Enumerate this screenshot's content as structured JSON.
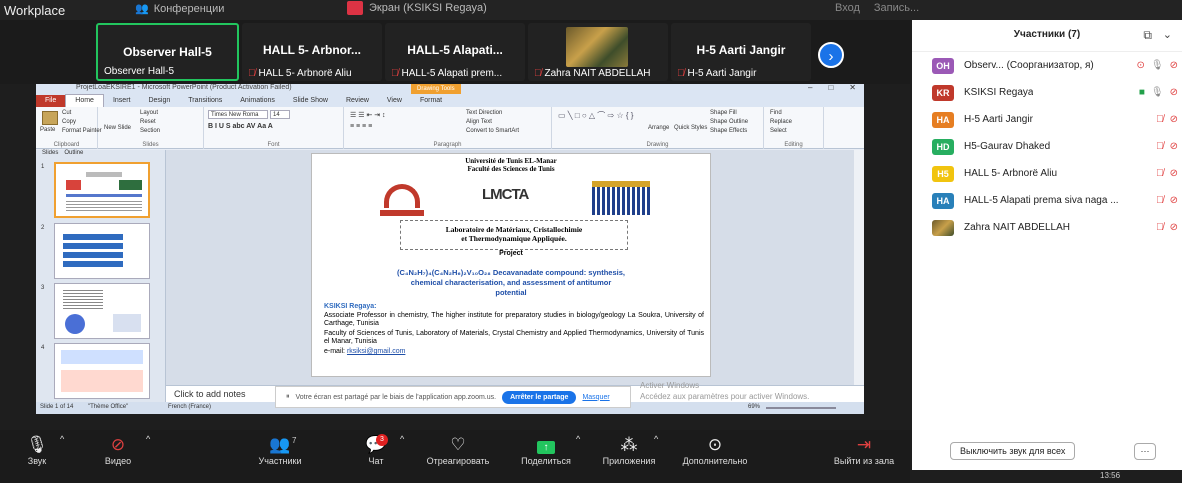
{
  "topbar": {
    "workspace": "Workplace",
    "conference_label": "Конференции",
    "share_label": "Экран (KSIKSI Regaya)",
    "right_items": [
      "Вход",
      "Запись..."
    ]
  },
  "strip": {
    "tiles": [
      {
        "big": "Observer  Hall-5",
        "small": "Observer  Hall-5",
        "muted": false
      },
      {
        "big": "HALL 5- Arbnor...",
        "small": "HALL 5- Arbnorë Aliu",
        "muted": true
      },
      {
        "big": "HALL-5 Alapati...",
        "small": "HALL-5 Alapati prem...",
        "muted": true
      },
      {
        "big": "",
        "small": "Zahra NAIT ABDELLAH",
        "muted": true
      },
      {
        "big": "H-5 Aarti Jangir",
        "small": "H-5 Aarti Jangir",
        "muted": true
      }
    ],
    "next_icon": "›"
  },
  "ppt": {
    "title": "ProjetLoaEKSIRE1 - Microsoft PowerPoint (Product Activation Failed)",
    "context_tab": "Drawing Tools",
    "tabs": [
      "File",
      "Home",
      "Insert",
      "Design",
      "Transitions",
      "Animations",
      "Slide Show",
      "Review",
      "View",
      "Format"
    ],
    "ribbon": {
      "clipboard": "Clipboard",
      "paste": "Paste",
      "cut": "Cut",
      "copy": "Copy",
      "format_painter": "Format Painter",
      "slides_group": "Slides",
      "new_slide": "New Slide",
      "layout": "Layout",
      "reset": "Reset",
      "section": "Section",
      "font_group": "Font",
      "font_name": "Times New Roma",
      "font_size": "14",
      "paragraph_group": "Paragraph",
      "text_direction": "Text Direction",
      "align_text": "Align Text",
      "convert_smartart": "Convert to SmartArt",
      "drawing_group": "Drawing",
      "arrange": "Arrange",
      "quick_styles": "Quick Styles",
      "shape_fill": "Shape Fill",
      "shape_outline": "Shape Outline",
      "shape_effects": "Shape Effects",
      "editing_group": "Editing",
      "find": "Find",
      "replace": "Replace",
      "select": "Select"
    },
    "pane_tabs": [
      "Slides",
      "Outline"
    ],
    "thumb_numbers": [
      "1",
      "2",
      "3",
      "4"
    ],
    "notes_placeholder": "Click to add notes",
    "status": {
      "slide": "Slide 1 of 14",
      "theme": "\"Thème Office\"",
      "lang": "French (France)",
      "zoom": "69%"
    }
  },
  "slide": {
    "university": "Université de Tunis EL-Manar",
    "faculty": "Faculté des Sciences de Tunis",
    "lab_logo": "LMCTA",
    "lab_name_1": "Laboratoire de Matériaux, Cristallochimie",
    "lab_name_2": "et Thermodynamique Appliquée.",
    "project": "Project",
    "title_1": "(C₄N₂H₇)₄(C₄N₂H₆)₂V₁₀O₂₈ Decavanadate compound: synthesis,",
    "title_2": "chemical characterisation, and assessment of antitumor",
    "title_3": "potential",
    "author": "KSIKSI Regaya:",
    "line1": "Associate Professor in chemistry, The higher institute for preparatory studies in biology/geology La Soukra, University of Carthage, Tunisia",
    "line2": "Faculty of Sciences of Tunis, Laboratory of Materials, Crystal Chemistry and Applied Thermodynamics, University of Tunis el Manar, Tunisia",
    "email_label": "e-mail:",
    "email": "rksiksi@gmail.com"
  },
  "share_note": {
    "text": "Votre écran est partagé par le biais de l'application app.zoom.us.",
    "stop": "Arrêter le partage",
    "mask": "Masquer"
  },
  "windows_activation": {
    "line1": "Activer Windows",
    "line2": "Accédez aux paramètres pour activer Windows."
  },
  "toolbar": {
    "audio": "Звук",
    "video": "Видео",
    "participants": "Участники",
    "participants_count": "7",
    "chat": "Чат",
    "chat_badge": "3",
    "react": "Отреагировать",
    "share": "Поделиться",
    "apps": "Приложения",
    "more": "Дополнительно",
    "leave": "Выйти из зала"
  },
  "panel": {
    "title": "Участники (7)",
    "participants": [
      {
        "initials": "OH",
        "color": "#9b59b6",
        "name": "Observ...  (Соорганизатор, я)",
        "mic": "on",
        "video": "off",
        "rec": true
      },
      {
        "initials": "KR",
        "color": "#c0392b",
        "name": "KSIKSI Regaya",
        "mic": "on",
        "video": "on",
        "rec": false
      },
      {
        "initials": "HA",
        "color": "#e67e22",
        "name": "H-5 Aarti Jangir",
        "mic": "off",
        "video": "off",
        "rec": false
      },
      {
        "initials": "HD",
        "color": "#27ae60",
        "name": "H5-Gaurav Dhaked",
        "mic": "off",
        "video": "off",
        "rec": false
      },
      {
        "initials": "H5",
        "color": "#f1c40f",
        "name": "HALL 5- Arbnorë Aliu",
        "mic": "off",
        "video": "off",
        "rec": false
      },
      {
        "initials": "HA",
        "color": "#2980b9",
        "name": "HALL-5 Alapati prema siva naga ...",
        "mic": "off",
        "video": "off",
        "rec": false
      },
      {
        "initials": "",
        "color": "#8a6d3b",
        "name": "Zahra NAIT ABDELLAH",
        "mic": "off",
        "video": "off",
        "rec": false
      }
    ],
    "mute_all": "Выключить звук для всех",
    "more": "···"
  },
  "clock": "13:56"
}
